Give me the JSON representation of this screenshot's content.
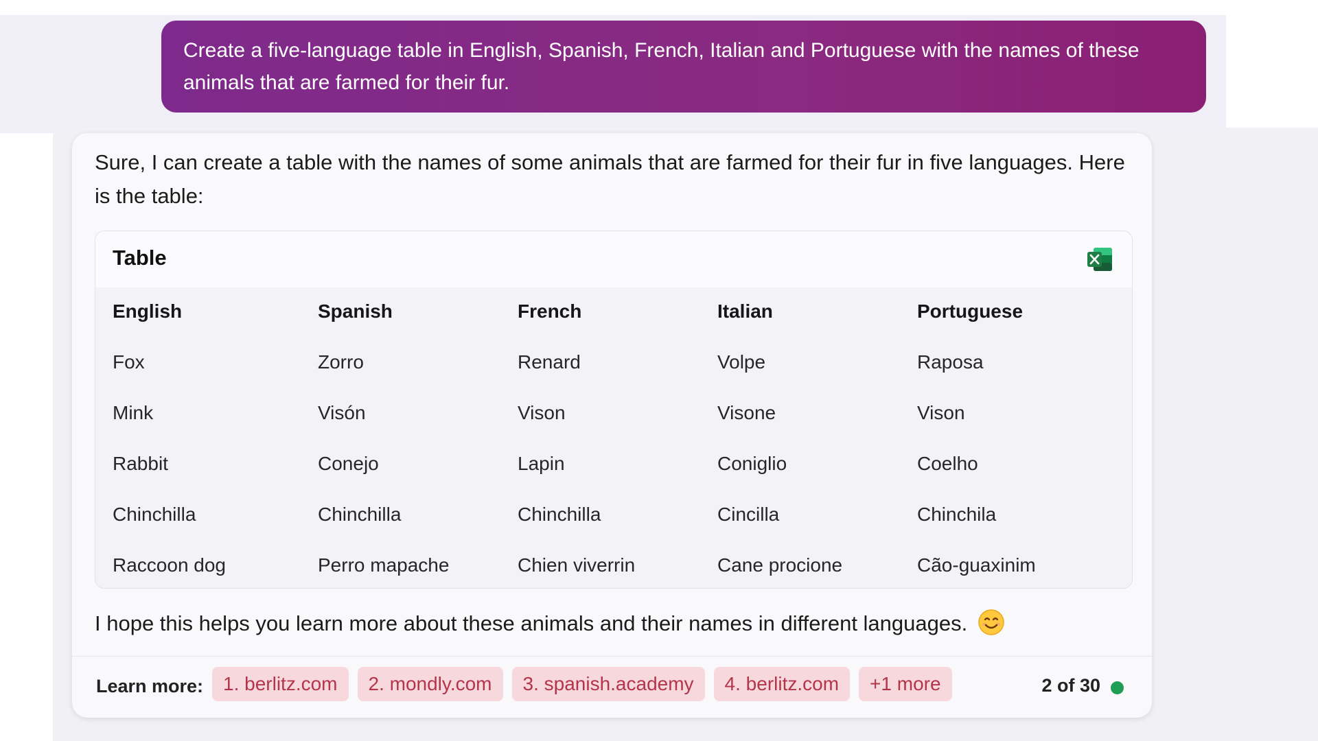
{
  "colors": {
    "user_bubble": "#84287f",
    "chip_bg": "#f7d9dd",
    "chip_text": "#b4344a",
    "status_dot": "#1f9d55",
    "excel_green": "#1e7e45"
  },
  "user_message": {
    "text": "Create a five-language table in English, Spanish, French, Italian and Portuguese with the names of these animals that are farmed for their fur."
  },
  "response": {
    "intro": "Sure, I can create a table with the names of some animals that are farmed for their fur in five languages. Here is the table:",
    "table": {
      "title": "Table",
      "export_icon": "excel-icon",
      "columns": [
        "English",
        "Spanish",
        "French",
        "Italian",
        "Portuguese"
      ],
      "rows": [
        [
          "Fox",
          "Zorro",
          "Renard",
          "Volpe",
          "Raposa"
        ],
        [
          "Mink",
          "Visón",
          "Vison",
          "Visone",
          "Vison"
        ],
        [
          "Rabbit",
          "Conejo",
          "Lapin",
          "Coniglio",
          "Coelho"
        ],
        [
          "Chinchilla",
          "Chinchilla",
          "Chinchilla",
          "Cincilla",
          "Chinchila"
        ],
        [
          "Raccoon dog",
          "Perro mapache",
          "Chien viverrin",
          "Cane procione",
          "Cão-guaxinim"
        ]
      ]
    },
    "outro": "I hope this helps you learn more about these animals and their names in different languages.",
    "outro_icon": "smiling-face-emoji-icon"
  },
  "footer": {
    "learn_more_label": "Learn more:",
    "sources": [
      "1. berlitz.com",
      "2. mondly.com",
      "3. spanish.academy",
      "4. berlitz.com",
      "+1 more"
    ],
    "counter": "2 of 30",
    "status_icon": "status-dot-icon"
  }
}
